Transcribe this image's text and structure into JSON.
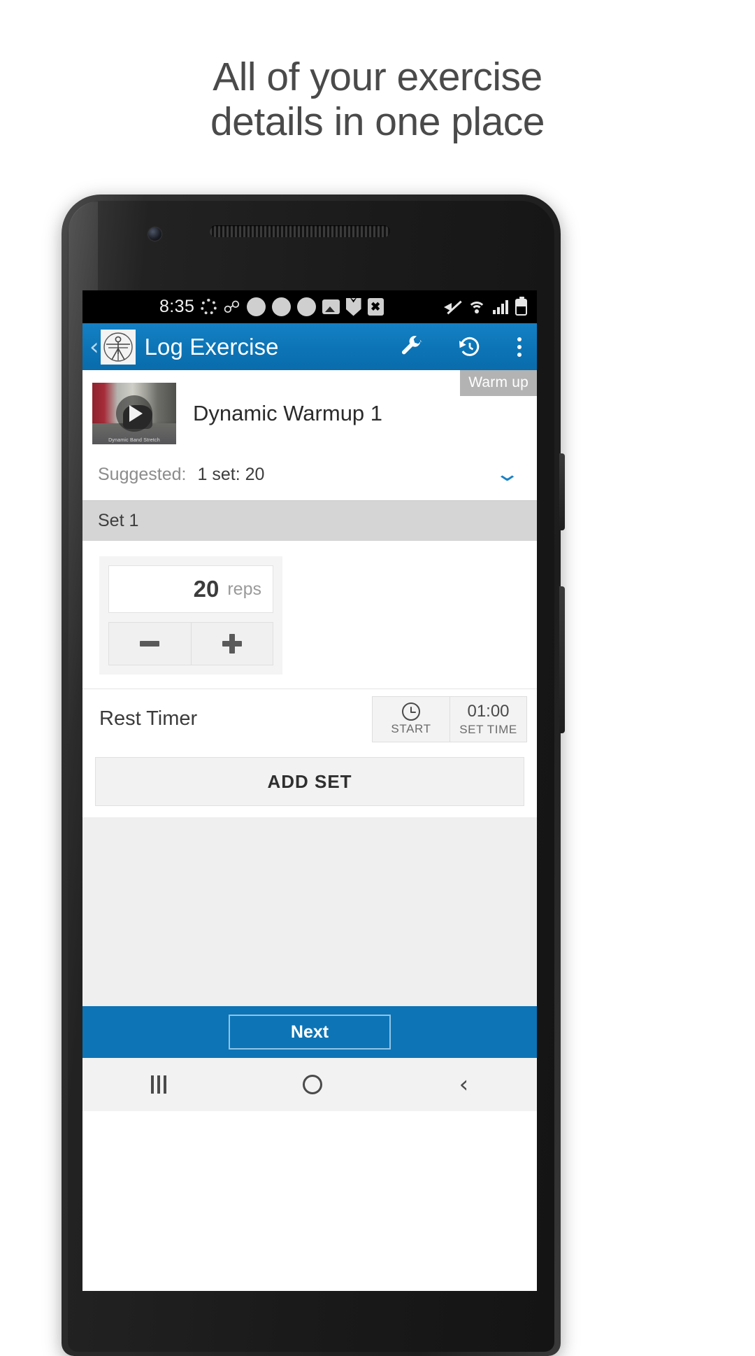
{
  "promo": {
    "headline_line1": "All of your exercise",
    "headline_line2": "details in one place"
  },
  "statusbar": {
    "time": "8:35",
    "left_icons": [
      "gear-icon",
      "gmail-icon",
      "dot-icon",
      "dot-icon",
      "dot-icon",
      "photo-icon",
      "shield-icon",
      "x-file-icon"
    ],
    "right_icons": [
      "mute-icon",
      "wifi-icon",
      "signal-icon",
      "battery-icon"
    ]
  },
  "appbar": {
    "back_glyph": "‹",
    "logo": "vitruvian-man-logo",
    "title": "Log Exercise",
    "actions": [
      {
        "name": "wrench-icon",
        "label": "Settings"
      },
      {
        "name": "history-icon",
        "label": "History"
      },
      {
        "name": "overflow-menu-icon",
        "label": "More options"
      }
    ]
  },
  "exercise": {
    "badge": "Warm up",
    "name": "Dynamic Warmup 1",
    "video_caption": "Dynamic Band Stretch",
    "play_label": "Play video",
    "suggested_label": "Suggested:",
    "suggested_value": "1 set: 20",
    "expand_glyph": "⌄"
  },
  "set": {
    "header": "Set 1",
    "reps_value": "20",
    "reps_unit": "reps",
    "decrement_label": "−",
    "increment_label": "+"
  },
  "rest_timer": {
    "label": "Rest Timer",
    "start_icon": "clock-icon",
    "start_label": "START",
    "time_value": "01:00",
    "time_label": "SET TIME"
  },
  "actions": {
    "add_set": "ADD SET",
    "next": "Next"
  },
  "navbar": {
    "recents_label": "Recents",
    "home_label": "Home",
    "back_glyph": "‹"
  },
  "colors": {
    "brand_blue": "#0d74b6",
    "badge_gray": "#b3b3b3",
    "set_header_gray": "#d5d5d5"
  }
}
